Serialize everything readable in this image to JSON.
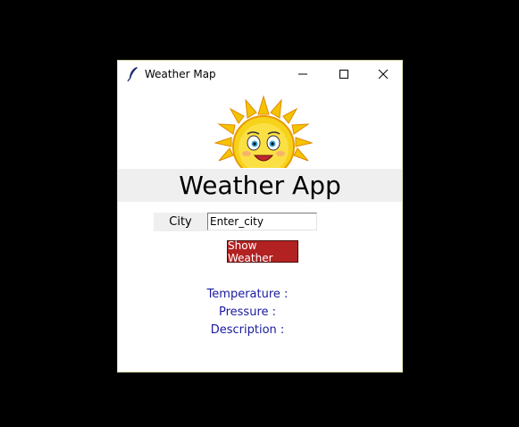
{
  "window": {
    "title": "Weather Map",
    "icon": "feather-icon"
  },
  "heading": "Weather App",
  "form": {
    "city_label": "City",
    "city_value": "Enter_city",
    "button_label": "Show Weather"
  },
  "info": {
    "temperature_label": "Temperature :",
    "pressure_label": "Pressure :",
    "description_label": "Description :"
  },
  "colors": {
    "button_bg": "#b22222",
    "info_text": "#1a1aa0",
    "heading_bg": "#efefef"
  }
}
